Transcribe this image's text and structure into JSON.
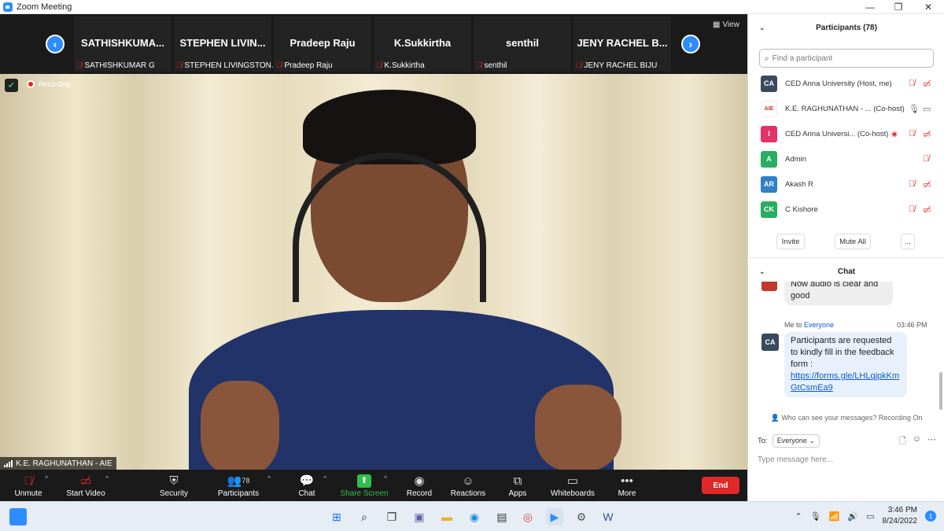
{
  "window": {
    "title": "Zoom Meeting",
    "minimize": "—",
    "maximize": "❐",
    "close": "✕"
  },
  "gallery": {
    "view_label": "View",
    "tiles": [
      {
        "name": "SATHISHKUMA...",
        "label": "SATHISHKUMAR G"
      },
      {
        "name": "STEPHEN LIVIN...",
        "label": "STEPHEN LIVINGSTON..."
      },
      {
        "name": "Pradeep Raju",
        "label": "Pradeep Raju"
      },
      {
        "name": "K.Sukkirtha",
        "label": "K.Sukkirtha"
      },
      {
        "name": "senthil",
        "label": "senthil"
      },
      {
        "name": "JENY RACHEL B...",
        "label": "JENY RACHEL BIJU"
      }
    ]
  },
  "speaker": {
    "recording_label": "Recording",
    "name": "K.E. RAGHUNATHAN - AIE"
  },
  "toolbar": {
    "unmute": "Unmute",
    "start_video": "Start Video",
    "security": "Security",
    "participants": "Participants",
    "participants_count": "78",
    "chat": "Chat",
    "share_screen": "Share Screen",
    "record": "Record",
    "reactions": "Reactions",
    "apps": "Apps",
    "whiteboards": "Whiteboards",
    "more": "More",
    "end": "End"
  },
  "participants_panel": {
    "title": "Participants (78)",
    "search_placeholder": "Find a participant",
    "list": [
      {
        "initials": "CA",
        "name": "CED Anna University (Host, me)",
        "color": "#3a4a5e"
      },
      {
        "initials": "AIE",
        "name": "K.E. RAGHUNATHAN - ...  (Co-host)",
        "color": "#ffffff"
      },
      {
        "initials": "I",
        "name": "CED Anna Universi...  (Co-host)",
        "color": "#e2336b"
      },
      {
        "initials": "A",
        "name": "Admin",
        "color": "#27ae60"
      },
      {
        "initials": "AR",
        "name": "Akash R",
        "color": "#2f80c8"
      },
      {
        "initials": "CK",
        "name": "C Kishore",
        "color": "#27ae60"
      }
    ],
    "invite": "Invite",
    "mute_all": "Mute All",
    "more": "..."
  },
  "chat_panel": {
    "title": "Chat",
    "prev_message": "Now audio is clear and good",
    "me_to": "Me to",
    "recipient": "Everyone",
    "time": "03:46 PM",
    "sender_initials": "CA",
    "message": "Participants are requested to kindly fill in the feedback form :",
    "link": "https://forms.gle/LHLqjpkKmGtCsmEa9",
    "who_can_see": "Who can see your messages? Recording On",
    "to_label": "To:",
    "to_value": "Everyone",
    "input_placeholder": "Type message here..."
  },
  "taskbar": {
    "time": "3:46 PM",
    "date": "8/24/2022",
    "notifications": "1"
  }
}
